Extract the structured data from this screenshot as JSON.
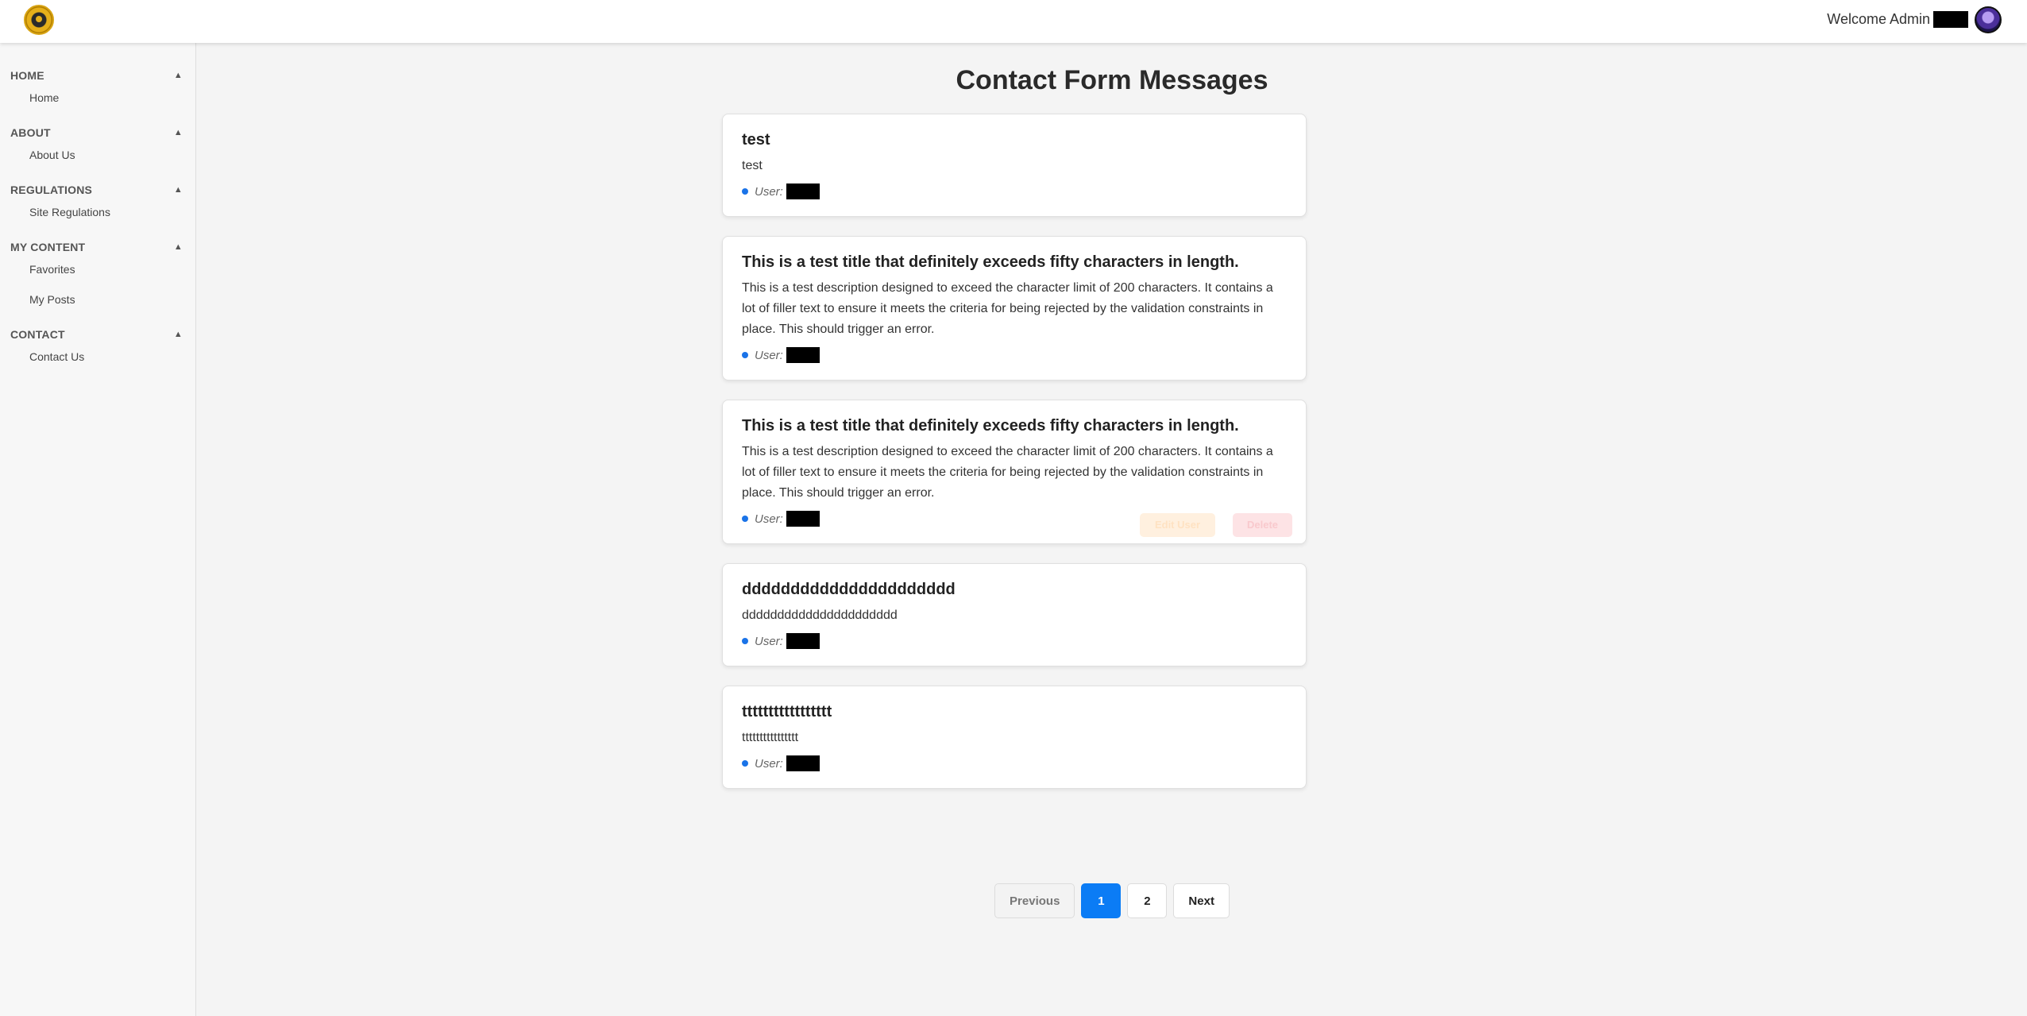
{
  "header": {
    "welcome_text": "Welcome Admin"
  },
  "sidebar": {
    "sections": [
      {
        "title": "HOME",
        "arrow": "▲",
        "items": [
          "Home"
        ]
      },
      {
        "title": "ABOUT",
        "arrow": "▲",
        "items": [
          "About Us"
        ]
      },
      {
        "title": "REGULATIONS",
        "arrow": "▲",
        "items": [
          "Site Regulations"
        ]
      },
      {
        "title": "MY CONTENT",
        "arrow": "▲",
        "items": [
          "Favorites",
          "My Posts"
        ]
      },
      {
        "title": "CONTACT",
        "arrow": "▲",
        "items": [
          "Contact Us"
        ]
      }
    ]
  },
  "main": {
    "title": "Contact Form Messages",
    "user_label": "User:",
    "messages": [
      {
        "title": "test",
        "description": "test"
      },
      {
        "title": "This is a test title that definitely exceeds fifty characters in length.",
        "description": "This is a test description designed to exceed the character limit of 200 characters. It contains a lot of filler text to ensure it meets the criteria for being rejected by the validation constraints in place. This should trigger an error."
      },
      {
        "title": "This is a test title that definitely exceeds fifty characters in length.",
        "description": "This is a test description designed to exceed the character limit of 200 characters. It contains a lot of filler text to ensure it meets the criteria for being rejected by the validation constraints in place. This should trigger an error.",
        "actions": {
          "edit": "Edit User",
          "delete": "Delete"
        }
      },
      {
        "title": "dddddddddddddddddddddd",
        "description": "dddddddddddddddddddddd"
      },
      {
        "title": "ttttttttttttttttt",
        "description": "tttttttttttttttt"
      }
    ]
  },
  "pagination": {
    "previous": "Previous",
    "pages": [
      "1",
      "2"
    ],
    "current": "1",
    "next": "Next"
  },
  "colors": {
    "accent": "#0b7cf5",
    "dot": "#1a73e8",
    "background": "#f4f4f4"
  }
}
